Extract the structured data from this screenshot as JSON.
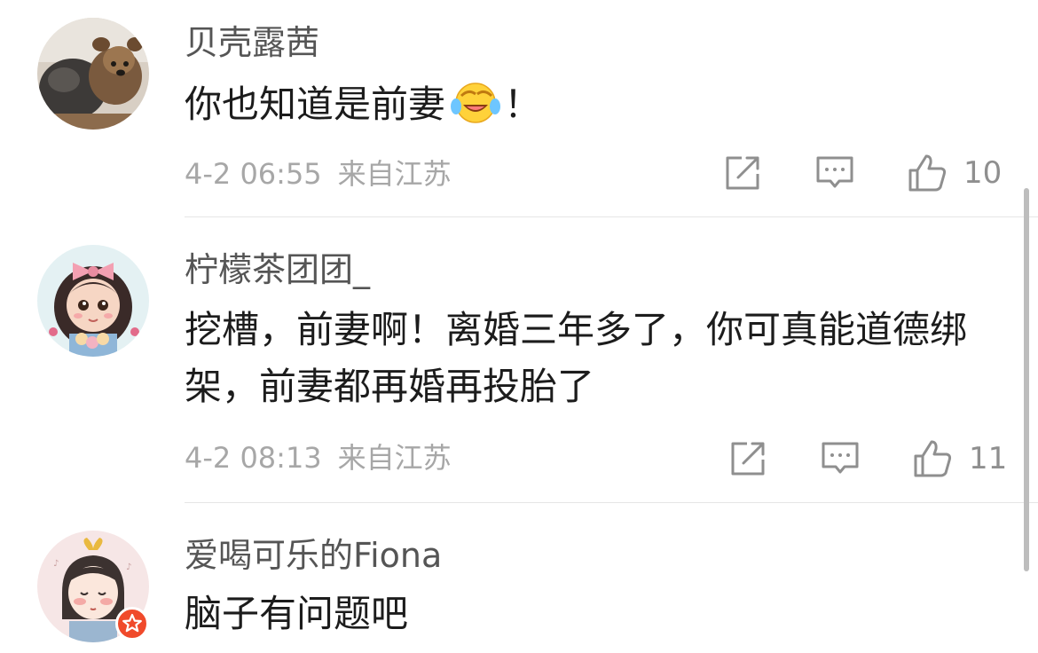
{
  "comments": [
    {
      "username": "贝壳露茜",
      "text": "你也知道是前妻",
      "emoji": "laughing-crying-emoji",
      "text_suffix": "！",
      "timestamp": "4-2 06:55",
      "location": "来自江苏",
      "likes": "10"
    },
    {
      "username": "柠檬茶团团_",
      "text": "挖槽，前妻啊！离婚三年多了，你可真能道德绑架，前妻都再婚再投胎了",
      "timestamp": "4-2 08:13",
      "location": "来自江苏",
      "likes": "11"
    },
    {
      "username": "爱喝可乐的Fiona",
      "text": "脑子有问题吧"
    }
  ],
  "icons": {
    "share": "share-icon",
    "reply": "comment-icon",
    "like": "thumbs-up-icon",
    "badge": "star-badge-icon"
  },
  "colors": {
    "username": "#555555",
    "text": "#1c1c1c",
    "meta": "#a7a7a7",
    "icon": "#8f8f8f",
    "badge": "#f04a2b"
  }
}
